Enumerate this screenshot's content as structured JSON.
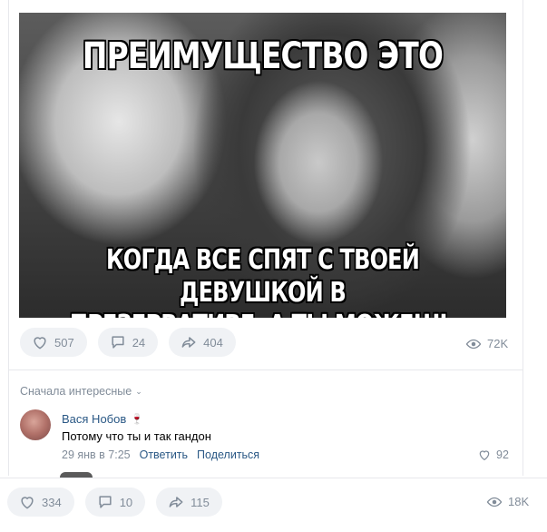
{
  "post": {
    "meme": {
      "top_text": "ПРЕИМУЩЕСТВО ЭТО",
      "bottom_text_line1": "КОГДА ВСЕ СПЯТ С ТВОЕЙ ДЕВУШКОЙ В",
      "bottom_text_line2": "ПРЕЗЕРВАТИВЕ, А ТЫ МОЖЕШЬ БЕЗ"
    },
    "actions": {
      "likes": "507",
      "comments": "24",
      "shares": "404",
      "views": "72K"
    }
  },
  "comments_section": {
    "sort_label": "Сначала интересные",
    "comment": {
      "author": "Вася Нобов",
      "author_badge_icon": "wine-glass-icon",
      "text": "Потому что ты и так гандон",
      "date": "29 янв в 7:25",
      "reply_label": "Ответить",
      "share_label": "Поделиться",
      "likes": "92"
    }
  },
  "next_post": {
    "actions": {
      "likes": "334",
      "comments": "10",
      "shares": "115",
      "views": "18K"
    }
  },
  "colors": {
    "link": "#2a5885",
    "muted": "#818c99",
    "pill_bg": "#f0f2f5",
    "badge": "#c0392b"
  }
}
